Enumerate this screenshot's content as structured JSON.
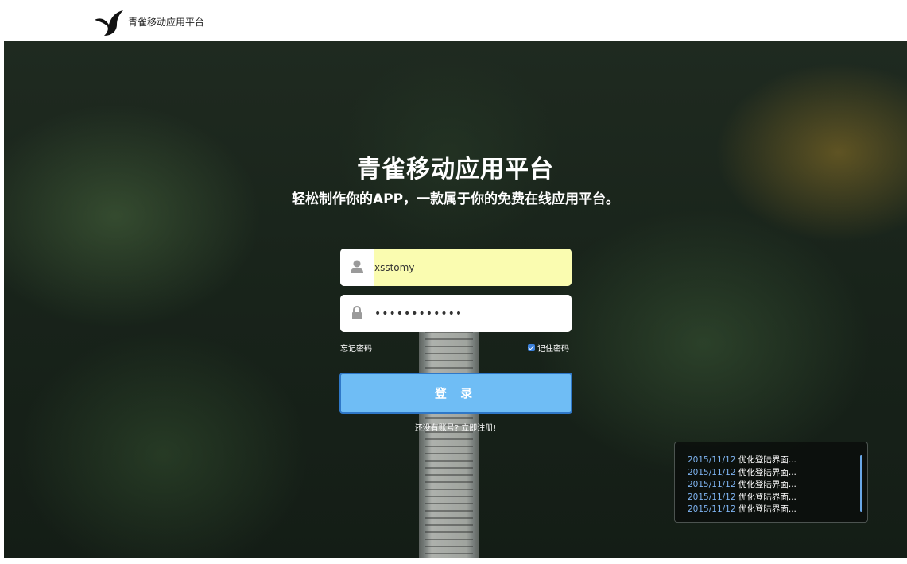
{
  "header": {
    "brand_name": "青雀移动应用平台",
    "logo_icon": "bird-logo-icon"
  },
  "hero": {
    "title": "青雀移动应用平台",
    "subtitle": "轻松制作你的APP，一款属于你的免费在线应用平台。"
  },
  "login_form": {
    "username_value": "xsstomy",
    "username_icon": "user-icon",
    "password_value": "••••••••••••",
    "password_icon": "lock-icon",
    "forgot_label": "忘记密码",
    "remember_label": "记住密码",
    "remember_checked": true,
    "submit_label": "登 录",
    "register_link": "还没有账号? 立即注册!"
  },
  "news": {
    "items": [
      {
        "date": "2015/11/12",
        "text": "优化登陆界面..."
      },
      {
        "date": "2015/11/12",
        "text": "优化登陆界面..."
      },
      {
        "date": "2015/11/12",
        "text": "优化登陆界面..."
      },
      {
        "date": "2015/11/12",
        "text": "优化登陆界面..."
      },
      {
        "date": "2015/11/12",
        "text": "优化登陆界面..."
      }
    ]
  },
  "colors": {
    "button_fill": "#6fbdf5",
    "button_border": "#2f78c8",
    "autofill_bg": "#fafcb0",
    "news_date": "#7fb4f2"
  }
}
